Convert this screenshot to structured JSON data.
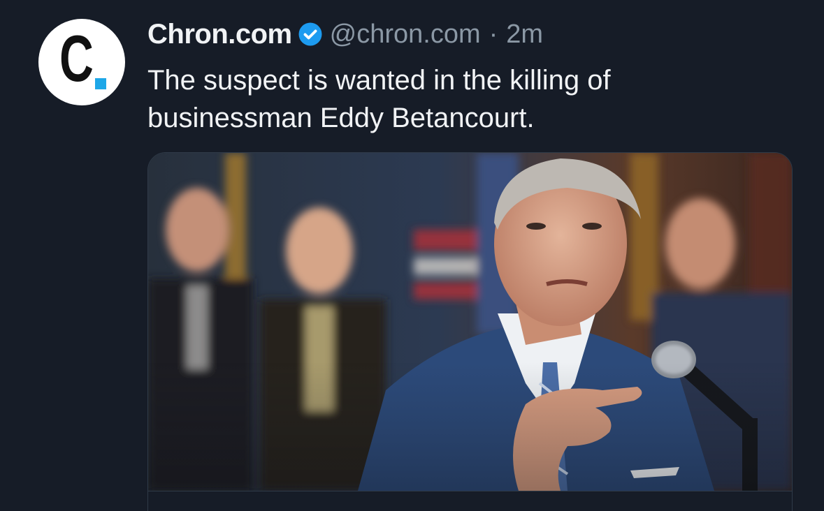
{
  "author": {
    "avatar_letter": "C",
    "display_name": "Chron.com",
    "verified": true,
    "handle": "@chron.com",
    "separator": "·",
    "timestamp": "2m"
  },
  "post": {
    "text": "The suspect is wanted in the killing of businessman Eddy Betancourt."
  },
  "media": {
    "type": "photo",
    "description_icon": "photo-of-speaker-at-microphone"
  },
  "colors": {
    "background": "#161c27",
    "text_primary": "#f1f3f5",
    "text_secondary": "#8b98a5",
    "verified_badge": "#1d9bf0",
    "avatar_accent": "#1ea7e8"
  }
}
